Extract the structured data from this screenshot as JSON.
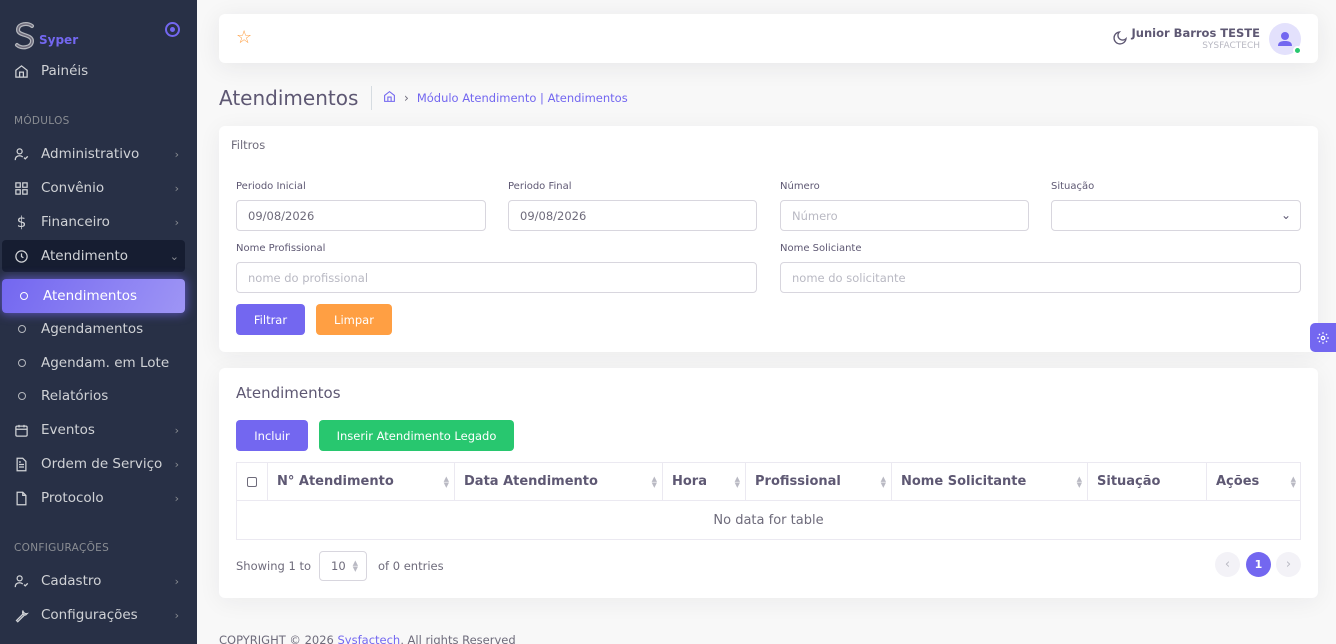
{
  "brand": {
    "name": "Syper"
  },
  "sidebar": {
    "paineis": "Painéis",
    "section_modulos": "MÓDULOS",
    "items": [
      {
        "label": "Administrativo",
        "icon": "user-check-icon"
      },
      {
        "label": "Convênio",
        "icon": "grid-icon"
      },
      {
        "label": "Financeiro",
        "icon": "dollar-icon"
      },
      {
        "label": "Atendimento",
        "icon": "clock-icon"
      }
    ],
    "sub_items": [
      "Atendimentos",
      "Agendamentos",
      "Agendam. em Lote",
      "Relatórios"
    ],
    "items2": [
      {
        "label": "Eventos",
        "icon": "calendar-icon"
      },
      {
        "label": "Ordem de Serviço",
        "icon": "file-text-icon"
      },
      {
        "label": "Protocolo",
        "icon": "file-icon"
      }
    ],
    "section_config": "CONFIGURAÇÕES",
    "items3": [
      {
        "label": "Cadastro",
        "icon": "user-check-icon"
      },
      {
        "label": "Configurações",
        "icon": "tool-icon"
      }
    ]
  },
  "navbar": {
    "user_name": "Junior Barros TESTE",
    "user_role": "SYSFACTECH"
  },
  "page": {
    "title": "Atendimentos",
    "breadcrumb": "Módulo Atendimento | Atendimentos"
  },
  "filters": {
    "title": "Filtros",
    "periodo_inicial_label": "Periodo Inicial",
    "periodo_inicial_value": "09/08/2026",
    "periodo_final_label": "Periodo Final",
    "periodo_final_value": "09/08/2026",
    "numero_label": "Número",
    "numero_placeholder": "Número",
    "situacao_label": "Situação",
    "situacao_value": "",
    "profissional_label": "Nome Profissional",
    "profissional_placeholder": "nome do profissional",
    "solicitante_label": "Nome Soliciante",
    "solicitante_placeholder": "nome do solicitante",
    "filtrar": "Filtrar",
    "limpar": "Limpar"
  },
  "table_card": {
    "title": "Atendimentos",
    "incluir": "Incluir",
    "inserir_legado": "Inserir Atendimento Legado",
    "columns": [
      "N° Atendimento",
      "Data Atendimento",
      "Hora",
      "Profissional",
      "Nome Solicitante",
      "Situação",
      "Ações"
    ],
    "no_data": "No data for table",
    "showing": "Showing 1 to",
    "per_page": "10",
    "of_entries": "of 0 entries",
    "current_page": "1"
  },
  "footer": {
    "prefix": "COPYRIGHT © 2026",
    "link": "Sysfactech",
    "suffix": ", All rights Reserved"
  }
}
